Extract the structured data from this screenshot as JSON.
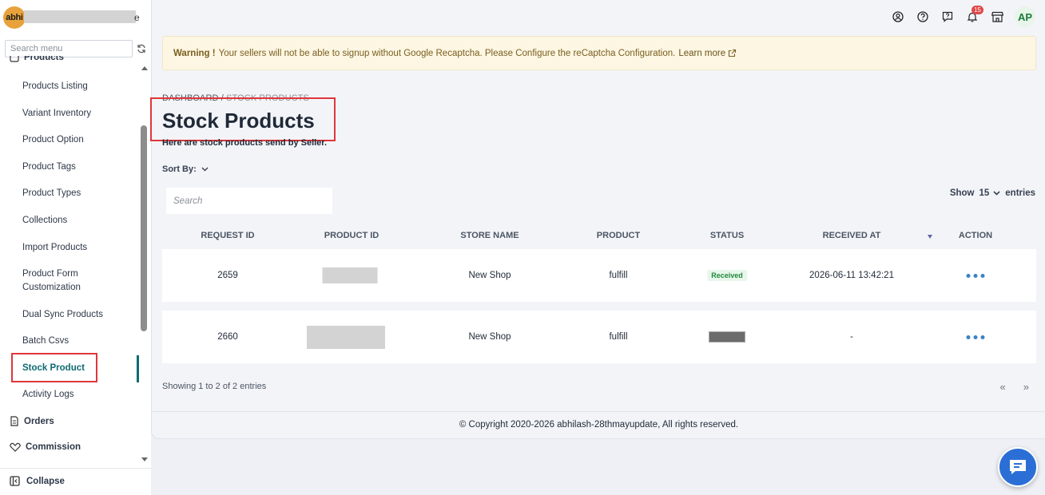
{
  "brand": {
    "logo_text": "abhi",
    "store_suffix": "e"
  },
  "sidebar": {
    "search_placeholder": "Search menu",
    "parent_label": "Products",
    "items": [
      {
        "label": "Products Listing"
      },
      {
        "label": "Variant Inventory"
      },
      {
        "label": "Product Option"
      },
      {
        "label": "Product Tags"
      },
      {
        "label": "Product Types"
      },
      {
        "label": "Collections"
      },
      {
        "label": "Import Products"
      },
      {
        "label": "Product Form Customization"
      },
      {
        "label": "Dual Sync Products"
      },
      {
        "label": "Batch Csvs"
      },
      {
        "label": "Stock Product"
      },
      {
        "label": "Activity Logs"
      }
    ],
    "orders_label": "Orders",
    "commission_label": "Commission",
    "collapse_label": "Collapse"
  },
  "topbar": {
    "notification_count": "15",
    "avatar_initials": "AP"
  },
  "warning": {
    "strong": "Warning !",
    "message": "Your sellers will not be able to signup without Google Recaptcha. Please Configure the reCaptcha Configuration.",
    "link": "Learn more"
  },
  "breadcrumb": {
    "root": "DASHBOARD",
    "sep": "/",
    "current": "STOCK PRODUCTS"
  },
  "page": {
    "title": "Stock Products",
    "subtitle": "Here are stock products send by Seller."
  },
  "sort": {
    "label": "Sort By:"
  },
  "table": {
    "search_placeholder": "Search",
    "show_label": "Show",
    "entries_value": "15",
    "entries_label": "entries",
    "columns": [
      "REQUEST ID",
      "PRODUCT ID",
      "STORE NAME",
      "PRODUCT",
      "STATUS",
      "RECEIVED AT",
      "ACTION"
    ],
    "rows": [
      {
        "request_id": "2659",
        "store_name": "New Shop",
        "product": "fulfill",
        "status": "Received",
        "received_at": "2026-06-11 13:42:21"
      },
      {
        "request_id": "2660",
        "store_name": "New Shop",
        "product": "fulfill",
        "status": "",
        "received_at": "-"
      }
    ],
    "showing": "Showing 1 to 2 of 2 entries",
    "prev": "«",
    "next": "»"
  },
  "footer": {
    "copyright": "© Copyright 2020-2026 abhilash-28thmayupdate, All rights reserved."
  },
  "colors": {
    "accent": "#0e6b73",
    "highlight": "#e0363a",
    "chat": "#2b6fd6"
  }
}
